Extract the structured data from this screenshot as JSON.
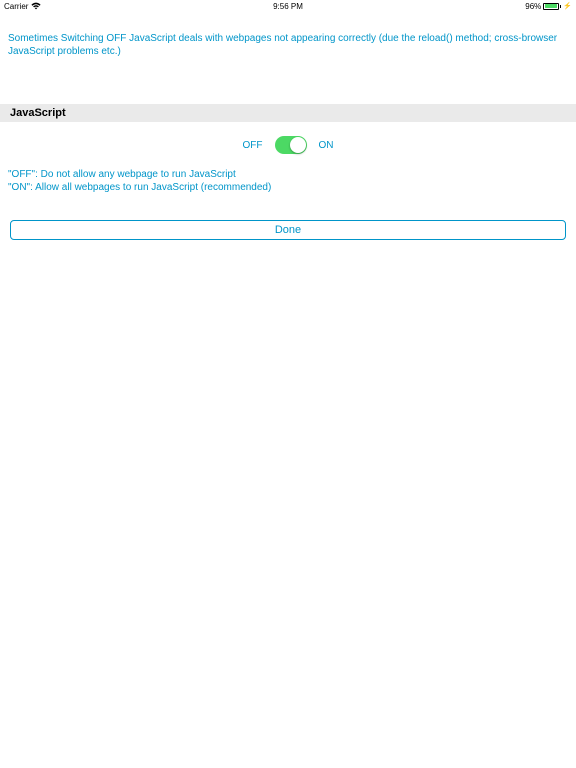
{
  "status_bar": {
    "carrier": "Carrier",
    "time": "9:56 PM",
    "battery_percent": "96%"
  },
  "description": "Sometimes Switching OFF JavaScript deals with webpages not appearing correctly (due the reload() method; cross-browser JavaScript problems etc.)",
  "section_title": "JavaScript",
  "toggle": {
    "off_label": "OFF",
    "on_label": "ON"
  },
  "explanation": {
    "off_line": "\"OFF\":  Do  not  allow  any  webpage  to  run  JavaScript",
    "on_line": "\"ON\": Allow all webpages to run JavaScript (recommended)"
  },
  "done_button": "Done"
}
